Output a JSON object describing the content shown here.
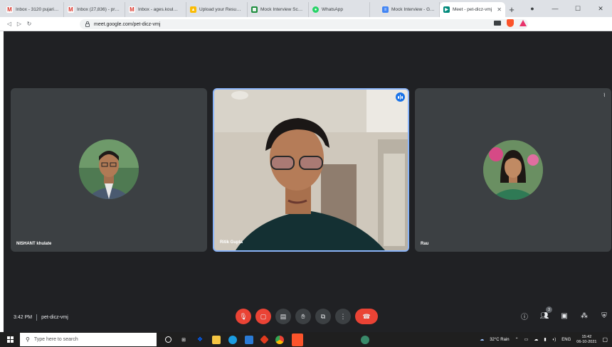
{
  "browser": {
    "tabs": [
      {
        "icon": "gmail-icon",
        "title": "Inbox - 3120 pujariab..."
      },
      {
        "icon": "gmail-icon",
        "title": "Inbox (27,836) - prajur..."
      },
      {
        "icon": "gmail-icon",
        "title": "Inbox - ages.koul@int..."
      },
      {
        "icon": "drive-icon",
        "title": "Upload your Resume |"
      },
      {
        "icon": "sheet-icon",
        "title": "Mock Interview Sched..."
      },
      {
        "icon": "whatsapp-icon",
        "title": "WhatsApp"
      },
      {
        "icon": "doc-icon",
        "title": "Mock Interview - Goo..."
      },
      {
        "icon": "meet-icon",
        "title": "Meet - pet-dicz-vmj",
        "active": true
      }
    ],
    "new_tab": "+",
    "window_controls": {
      "minimize": "—",
      "maximize": "☐",
      "close": "✕"
    },
    "address": {
      "url": "meet.google.com/pet-dicz-vmj"
    }
  },
  "meet": {
    "participants": [
      {
        "name": "NISHANT khulate",
        "presenting": false
      },
      {
        "name": "Ritik Gupta",
        "presenting": true
      },
      {
        "name": "Rau",
        "presenting": false
      }
    ],
    "time": "3:42 PM",
    "code": "pet-dicz-vmj",
    "people_count": "3"
  },
  "taskbar": {
    "search_placeholder": "Type here to search",
    "weather": "32°C Rain",
    "lang": "ENG",
    "clock_time": "15:42",
    "clock_date": "06-10-2021"
  },
  "colors": {
    "meet_bg": "#202124",
    "tile_bg": "#3c4043",
    "active_border": "#8ab4f8",
    "danger": "#ea4335"
  }
}
